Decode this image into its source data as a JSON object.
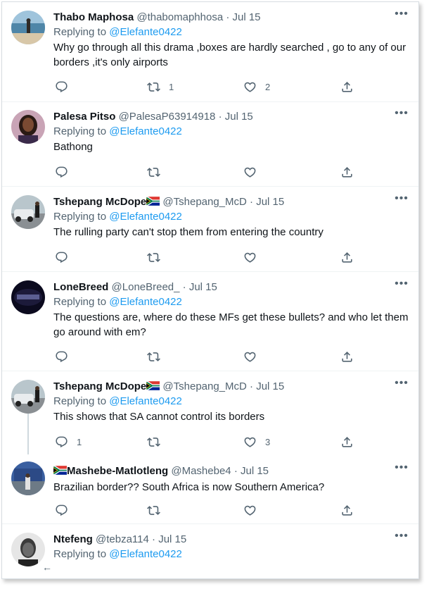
{
  "tweets": [
    {
      "name": "Thabo Maphosa",
      "handle": "@thabomaphhosa",
      "date": "Jul 15",
      "replying_prefix": "Replying to",
      "replying_to": "@Elefante0422",
      "text": "Why go through all this drama ,boxes are hardly searched , go to any of our borders ,it's only airports",
      "retweets": "1",
      "likes": "2",
      "replies": ""
    },
    {
      "name": "Palesa Pitso",
      "handle": "@PalesaP63914918",
      "date": "Jul 15",
      "replying_prefix": "Replying to",
      "replying_to": "@Elefante0422",
      "text": "Bathong",
      "retweets": "",
      "likes": "",
      "replies": ""
    },
    {
      "name": "Tshepang McDope",
      "handle": "@Tshepang_McD",
      "date": "Jul 15",
      "replying_prefix": "Replying to",
      "replying_to": "@Elefante0422",
      "text": "The rulling party can't stop them from entering the country",
      "retweets": "",
      "likes": "",
      "replies": ""
    },
    {
      "name": "LoneBreed",
      "handle": "@LoneBreed_",
      "date": "Jul 15",
      "replying_prefix": "Replying to",
      "replying_to": "@Elefante0422",
      "text": "The questions are, where do these MFs get these bullets? and who let them go around with em?",
      "retweets": "",
      "likes": "",
      "replies": ""
    },
    {
      "name": "Tshepang McDope",
      "handle": "@Tshepang_McD",
      "date": "Jul 15",
      "replying_prefix": "Replying to",
      "replying_to": "@Elefante0422",
      "text": "This shows that SA cannot control its borders",
      "retweets": "",
      "likes": "3",
      "replies": "1"
    },
    {
      "name": "Mashebe-Matlotleng",
      "handle": "@Mashebe4",
      "date": "Jul 15",
      "text": "Brazilian border?? South Africa is now  Southern America?",
      "retweets": "",
      "likes": "",
      "replies": ""
    },
    {
      "name": "Ntefeng",
      "handle": "@tebza114",
      "date": "Jul 15",
      "replying_prefix": "Replying to",
      "replying_to": "@Elefante0422"
    }
  ],
  "separator": "·",
  "more_glyph": "•••",
  "back_glyph": "←",
  "colors": {
    "mention": "#1d9bf0",
    "secondary": "#536471",
    "text": "#0f1419"
  }
}
